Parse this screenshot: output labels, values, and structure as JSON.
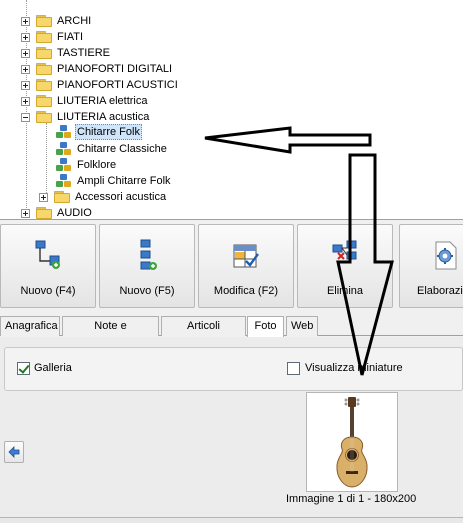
{
  "tree": {
    "items": [
      {
        "label": "ARCHI",
        "type": "folder",
        "expander": "plus"
      },
      {
        "label": "FIATI",
        "type": "folder",
        "expander": "plus"
      },
      {
        "label": "TASTIERE",
        "type": "folder",
        "expander": "plus"
      },
      {
        "label": "PIANOFORTI DIGITALI",
        "type": "folder",
        "expander": "plus"
      },
      {
        "label": "PIANOFORTI ACUSTICI",
        "type": "folder",
        "expander": "plus"
      },
      {
        "label": "LIUTERIA elettrica",
        "type": "folder",
        "expander": "plus"
      },
      {
        "label": "LIUTERIA acustica",
        "type": "folder",
        "expander": "minus"
      },
      {
        "label": "Chitarre Folk",
        "type": "category",
        "selected": true
      },
      {
        "label": "Chitarre Classiche",
        "type": "category"
      },
      {
        "label": "Folklore",
        "type": "category"
      },
      {
        "label": "Ampli Chitarre Folk",
        "type": "category"
      },
      {
        "label": "Accessori acustica",
        "type": "folder",
        "expander": "plus"
      },
      {
        "label": "AUDIO",
        "type": "folder",
        "expander": "plus"
      }
    ]
  },
  "toolbar": {
    "buttons": [
      {
        "label": "Nuovo (F4)",
        "icon": "tree-add-child-icon"
      },
      {
        "label": "Nuovo (F5)",
        "icon": "tree-add-sibling-icon"
      },
      {
        "label": "Modifica (F2)",
        "icon": "edit-grid-icon"
      },
      {
        "label": "Elimina",
        "icon": "tree-delete-icon"
      },
      {
        "label": "Elaborazi",
        "icon": "gear-process-icon"
      }
    ]
  },
  "tabs": [
    {
      "label": "Anagrafica"
    },
    {
      "label": "Note e descrizioni"
    },
    {
      "label": "Articoli collegati"
    },
    {
      "label": "Foto",
      "active": true
    },
    {
      "label": "Web"
    }
  ],
  "gallery": {
    "galleria_label": "Galleria",
    "galleria_checked": true,
    "miniature_label": "Visualizza miniature",
    "miniature_checked": false,
    "caption": "Immagine 1 di 1 - 180x200"
  },
  "colors": {
    "selection": "#cfe5fb",
    "annotation_arrow": "#000000"
  }
}
